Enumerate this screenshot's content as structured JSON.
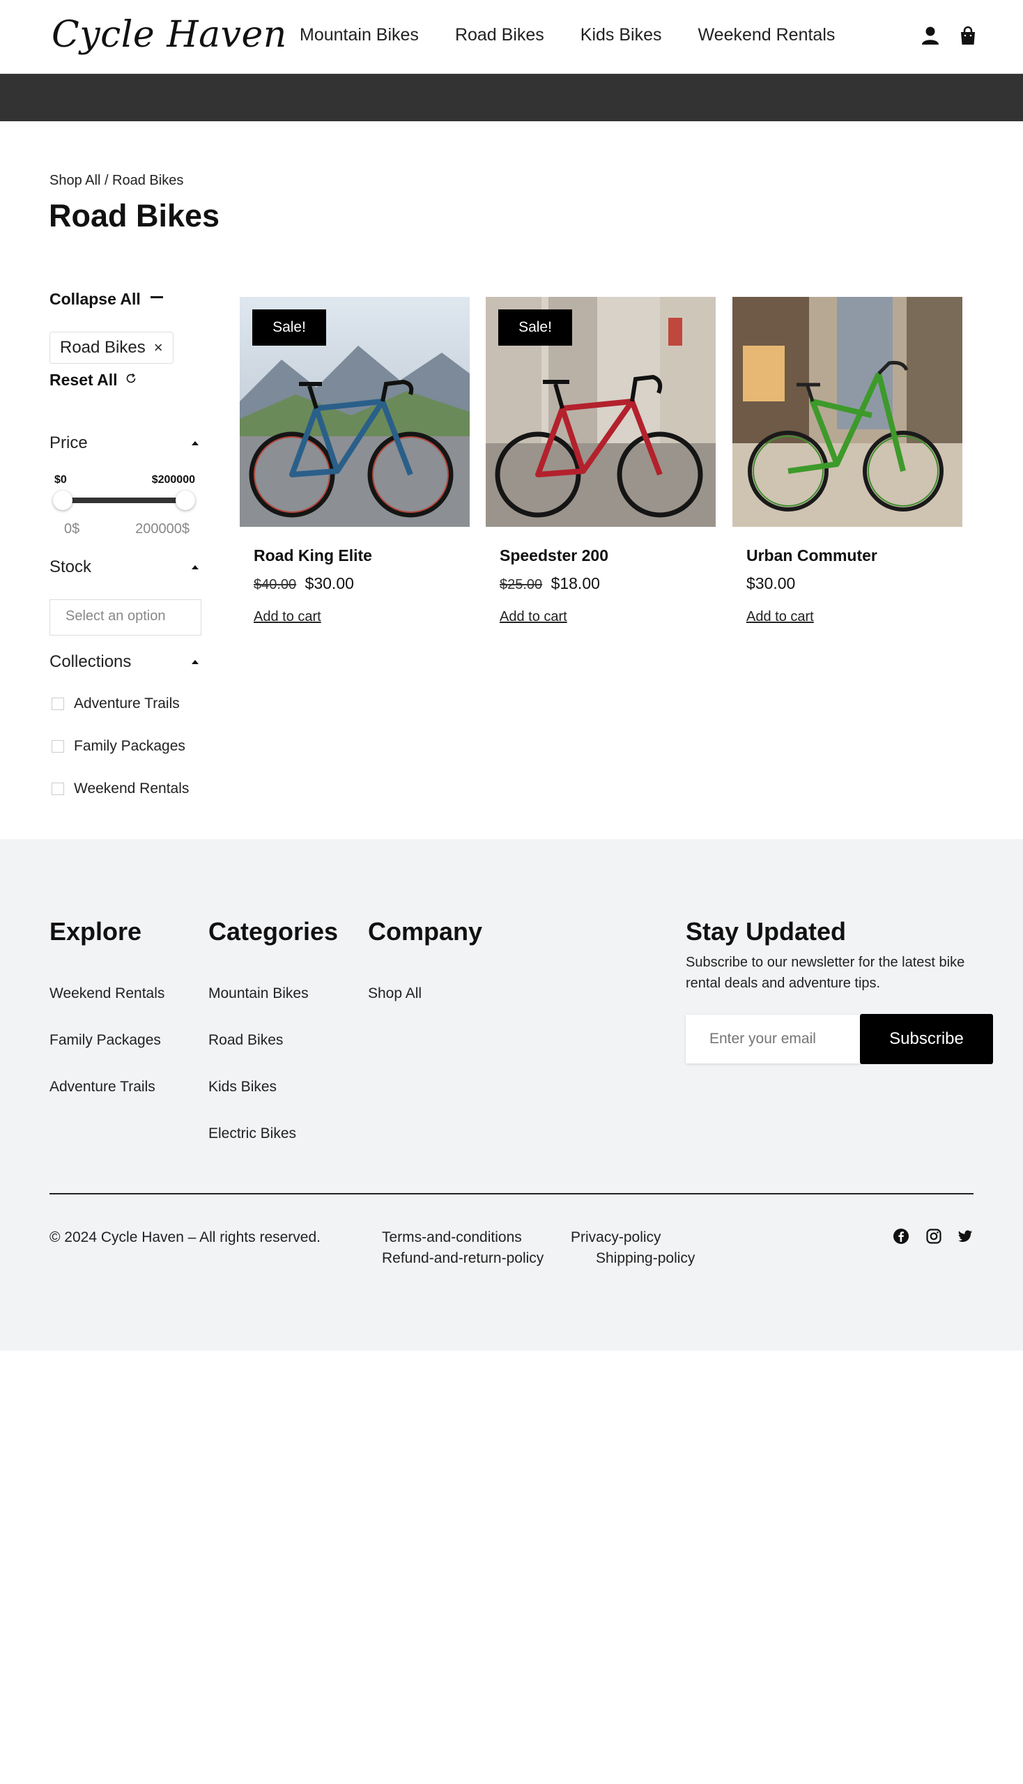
{
  "header": {
    "logo": "Cycle Haven",
    "nav": [
      "Mountain Bikes",
      "Road Bikes",
      "Kids Bikes",
      "Weekend Rentals"
    ],
    "icons": [
      "user-icon",
      "shopping-bag-icon"
    ]
  },
  "breadcrumb": "Shop All / Road Bikes",
  "page_title": "Road Bikes",
  "sidebar": {
    "collapse_all": "Collapse All",
    "active_filter": "Road Bikes",
    "active_filter_remove": "×",
    "reset_all": "Reset All",
    "price": {
      "label": "Price",
      "min_label": "$0",
      "max_label": "$200000",
      "range_min": "0$",
      "range_max": "200000$"
    },
    "stock": {
      "label": "Stock",
      "placeholder": "Select an option"
    },
    "collections": {
      "label": "Collections",
      "items": [
        "Adventure Trails",
        "Family Packages",
        "Weekend Rentals"
      ]
    }
  },
  "products": [
    {
      "name": "Road King Elite",
      "badge": "Sale!",
      "old_price": "$40.00",
      "price": "$30.00",
      "cart": "Add to cart"
    },
    {
      "name": "Speedster 200",
      "badge": "Sale!",
      "old_price": "$25.00",
      "price": "$18.00",
      "cart": "Add to cart"
    },
    {
      "name": "Urban Commuter",
      "price": "$30.00",
      "cart": "Add to cart"
    }
  ],
  "footer": {
    "explore": {
      "title": "Explore",
      "links": [
        "Weekend Rentals",
        "Family Packages",
        "Adventure Trails"
      ]
    },
    "categories": {
      "title": "Categories",
      "links": [
        "Mountain Bikes",
        "Road Bikes",
        "Kids Bikes",
        "Electric Bikes"
      ]
    },
    "company": {
      "title": "Company",
      "links": [
        "Shop All"
      ]
    },
    "newsletter": {
      "title": "Stay Updated",
      "text": "Subscribe to our newsletter for the latest bike rental deals and adventure tips.",
      "placeholder": "Enter your email",
      "button": "Subscribe"
    },
    "copyright": "© 2024 Cycle Haven – All rights reserved.",
    "legal": [
      "Terms-and-conditions",
      "Privacy-policy",
      "Refund-and-return-policy",
      "Shipping-policy"
    ],
    "social": [
      "facebook-icon",
      "instagram-icon",
      "twitter-icon"
    ]
  }
}
